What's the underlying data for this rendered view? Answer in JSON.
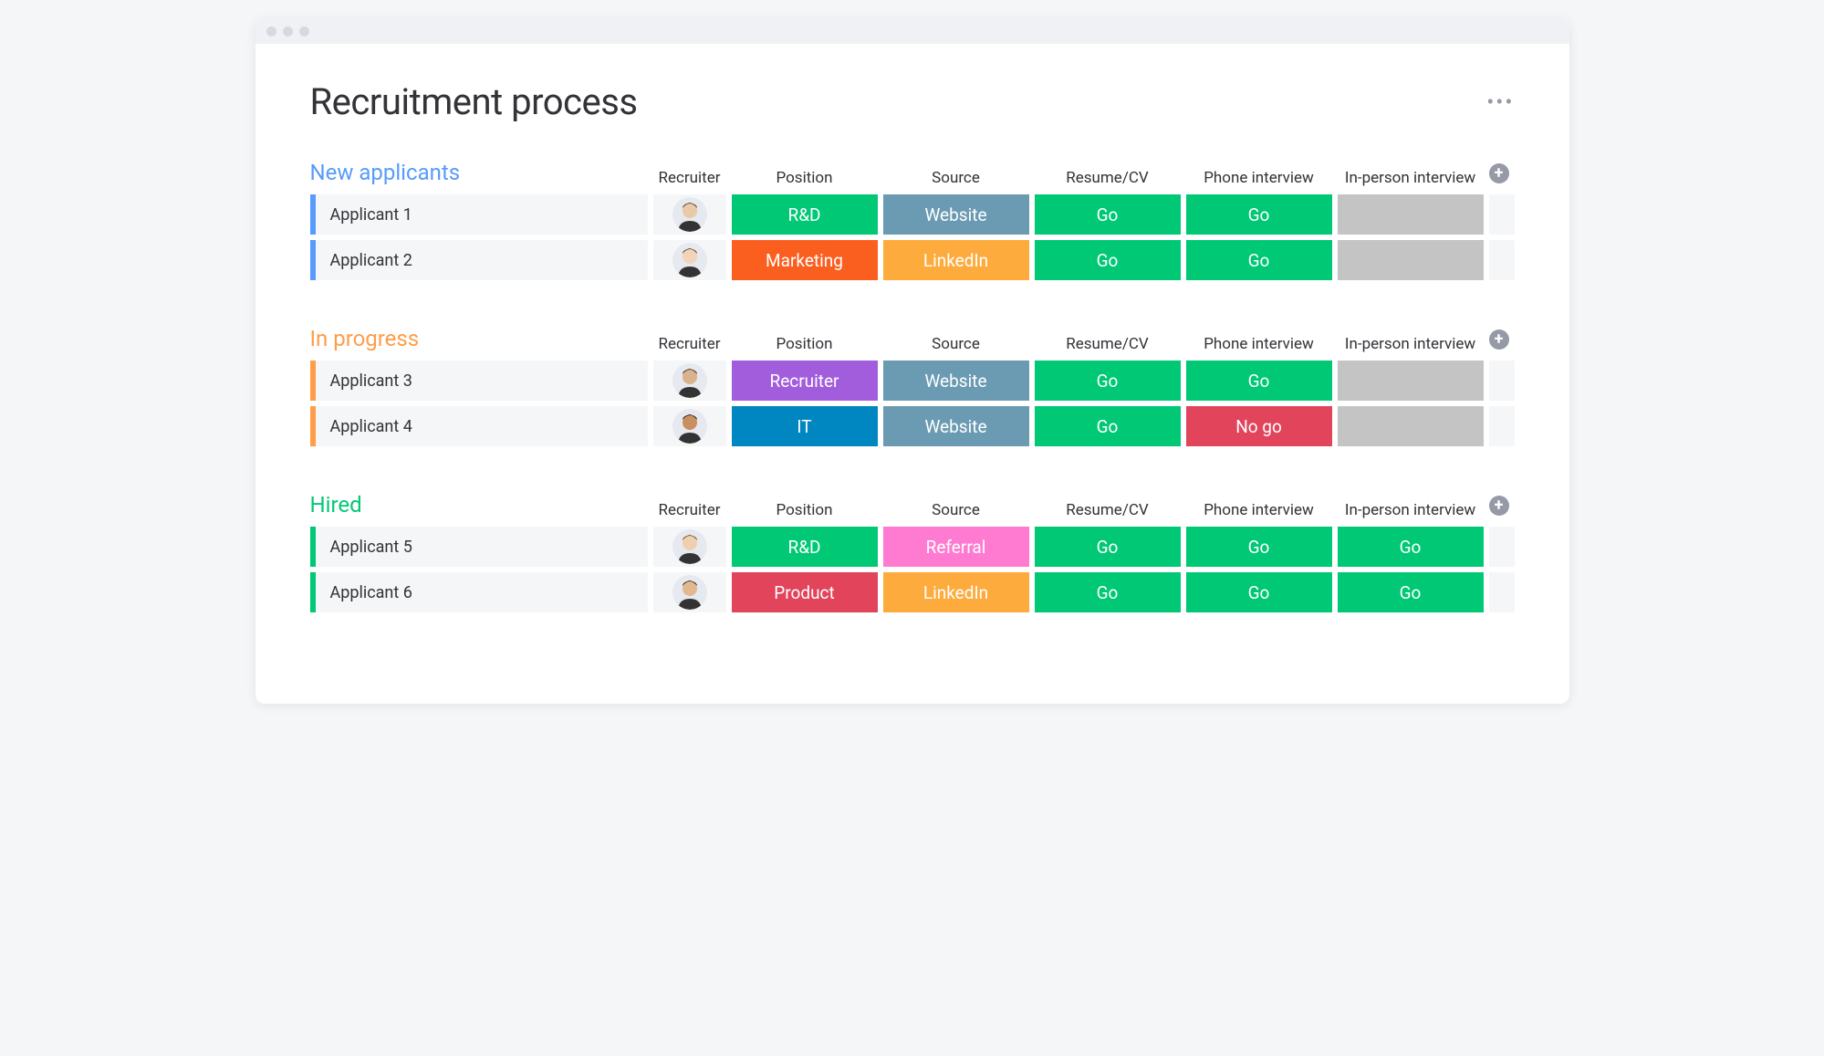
{
  "page": {
    "title": "Recruitment process"
  },
  "columns": {
    "recruiter": "Recruiter",
    "position": "Position",
    "source": "Source",
    "resume": "Resume/CV",
    "phone": "Phone interview",
    "inperson": "In-person interview"
  },
  "colors": {
    "green": "#00c875",
    "orange_deep": "#fb5f20",
    "slate": "#6b9bb3",
    "amber": "#fdab3d",
    "purple": "#a25ddc",
    "blue": "#0086c0",
    "red": "#e2445c",
    "pink": "#ff7bd1",
    "grey": "#c4c4c4"
  },
  "groups": [
    {
      "title": "New applicants",
      "accent": "blue",
      "rows": [
        {
          "name": "Applicant 1",
          "avatar": "m1",
          "position": {
            "label": "R&D",
            "color": "green"
          },
          "source": {
            "label": "Website",
            "color": "slate"
          },
          "resume": {
            "label": "Go",
            "color": "green"
          },
          "phone": {
            "label": "Go",
            "color": "green"
          },
          "inperson": {
            "label": "",
            "color": "grey"
          }
        },
        {
          "name": "Applicant 2",
          "avatar": "f1",
          "position": {
            "label": "Marketing",
            "color": "orange_deep"
          },
          "source": {
            "label": "LinkedIn",
            "color": "amber"
          },
          "resume": {
            "label": "Go",
            "color": "green"
          },
          "phone": {
            "label": "Go",
            "color": "green"
          },
          "inperson": {
            "label": "",
            "color": "grey"
          }
        }
      ]
    },
    {
      "title": "In progress",
      "accent": "orange",
      "rows": [
        {
          "name": "Applicant 3",
          "avatar": "f2",
          "position": {
            "label": "Recruiter",
            "color": "purple"
          },
          "source": {
            "label": "Website",
            "color": "slate"
          },
          "resume": {
            "label": "Go",
            "color": "green"
          },
          "phone": {
            "label": "Go",
            "color": "green"
          },
          "inperson": {
            "label": "",
            "color": "grey"
          }
        },
        {
          "name": "Applicant 4",
          "avatar": "m2",
          "position": {
            "label": "IT",
            "color": "blue"
          },
          "source": {
            "label": "Website",
            "color": "slate"
          },
          "resume": {
            "label": "Go",
            "color": "green"
          },
          "phone": {
            "label": "No go",
            "color": "red"
          },
          "inperson": {
            "label": "",
            "color": "grey"
          }
        }
      ]
    },
    {
      "title": "Hired",
      "accent": "green",
      "rows": [
        {
          "name": "Applicant 5",
          "avatar": "m3",
          "position": {
            "label": "R&D",
            "color": "green"
          },
          "source": {
            "label": "Referral",
            "color": "pink"
          },
          "resume": {
            "label": "Go",
            "color": "green"
          },
          "phone": {
            "label": "Go",
            "color": "green"
          },
          "inperson": {
            "label": "Go",
            "color": "green"
          }
        },
        {
          "name": "Applicant 6",
          "avatar": "f3",
          "position": {
            "label": "Product",
            "color": "red"
          },
          "source": {
            "label": "LinkedIn",
            "color": "amber"
          },
          "resume": {
            "label": "Go",
            "color": "green"
          },
          "phone": {
            "label": "Go",
            "color": "green"
          },
          "inperson": {
            "label": "Go",
            "color": "green"
          }
        }
      ]
    }
  ]
}
